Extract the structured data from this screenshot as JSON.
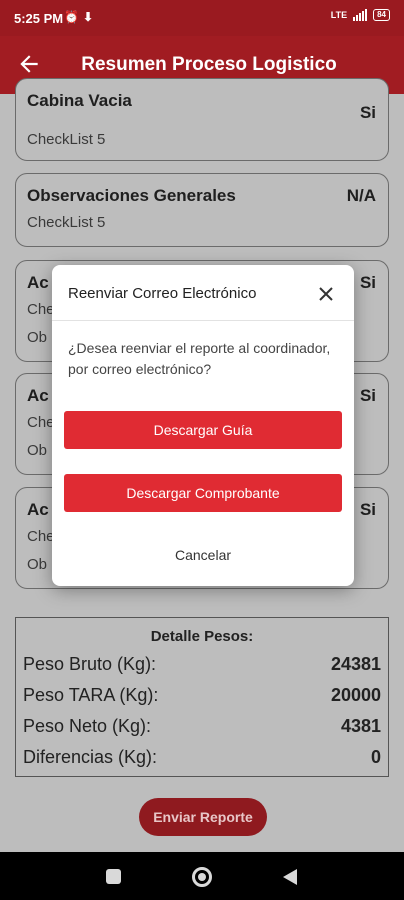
{
  "status_bar": {
    "time": "5:25 PM",
    "battery": "84",
    "network_label": "LTE"
  },
  "app_bar": {
    "title": "Resumen Proceso Logistico",
    "back_icon": "arrow-left-icon"
  },
  "cards": [
    {
      "name": "Cabina Vacia",
      "sub": "CheckList 5",
      "value": "Si"
    },
    {
      "name": "Observaciones Generales",
      "sub": "CheckList 5",
      "value": "N/A"
    },
    {
      "name": "Ac",
      "sub": "Che",
      "sub2": "Ob",
      "value": "Si"
    },
    {
      "name": "Ac",
      "sub": "Che",
      "sub2": "Ob",
      "value": "Si"
    },
    {
      "name": "Ac",
      "sub": "Che",
      "sub2": "Ob",
      "value": "Si"
    }
  ],
  "pesos": {
    "title": "Detalle Pesos:",
    "rows": [
      {
        "label": "Peso Bruto (Kg):",
        "value": "24381"
      },
      {
        "label": "Peso TARA (Kg):",
        "value": "20000"
      },
      {
        "label": "Peso Neto (Kg):",
        "value": "4381"
      },
      {
        "label": "Diferencias (Kg):",
        "value": "0"
      }
    ]
  },
  "send_button": "Enviar Reporte",
  "dialog": {
    "title": "Reenviar Correo Electrónico",
    "message": "¿Desea reenviar el reporte al coordinador, por correo electrónico?",
    "button_guia": "Descargar Guía",
    "button_comprobante": "Descargar Comprobante",
    "cancel": "Cancelar"
  },
  "colors": {
    "primary": "#a11c22",
    "dialog_button": "#e02b33"
  }
}
